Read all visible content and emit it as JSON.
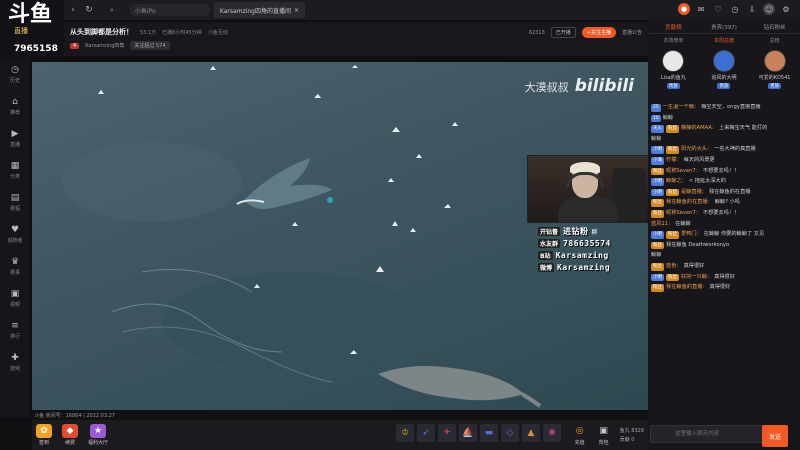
{
  "browser": {
    "search_text": "小鱼iPo",
    "tab_title": "Karsamzing四角的直播间",
    "icons": [
      "home-icon",
      "back-icon",
      "refresh-icon",
      "search-icon"
    ]
  },
  "logo": {
    "mark": "斗鱼",
    "sub": "直播",
    "number": "7965158"
  },
  "sidebar": {
    "items": [
      {
        "label": "历史",
        "icon": "history-icon"
      },
      {
        "label": "推荐",
        "icon": "home-icon"
      },
      {
        "label": "直播",
        "icon": "play-icon"
      },
      {
        "label": "分类",
        "icon": "grid-icon"
      },
      {
        "label": "赛程",
        "icon": "calendar-icon"
      },
      {
        "label": "追随者",
        "icon": "heart-icon"
      },
      {
        "label": "赛事",
        "icon": "trophy-icon"
      },
      {
        "label": "视频",
        "icon": "video-icon"
      },
      {
        "label": "排行",
        "icon": "rank-icon"
      },
      {
        "label": "游戏",
        "icon": "gamepad-icon"
      }
    ]
  },
  "room": {
    "title": "从头到脚都是分析！",
    "meta": [
      "53.1万",
      "已播8小时45分钟",
      "小鱼互动"
    ],
    "host_name": "Karsamzing四角",
    "level_badge": "4",
    "fan_badge": "关注超过 574",
    "room_id": "62313",
    "select": "已开播",
    "follow_label": "+关注主播",
    "share_label": "直播公告"
  },
  "player": {
    "watermark_cn": "大漠叔叔",
    "watermark_brand": "bilibili",
    "footer_text": "斗鱼 房间号：16864 | 2022.03.27"
  },
  "social": [
    {
      "label": "开钻督",
      "value": "进钻粉",
      "extra": "群"
    },
    {
      "label": "水友群",
      "value": "786635574",
      "extra": ""
    },
    {
      "label": "B站",
      "value": "Karsamzing",
      "extra": ""
    },
    {
      "label": "微博",
      "value": "Karsamzing",
      "extra": ""
    }
  ],
  "bottom": {
    "left_buttons": [
      {
        "label": "签到",
        "icon": "gift-icon",
        "color": "#f3a320"
      },
      {
        "label": "续费",
        "icon": "bag-icon",
        "color": "#e34b2c"
      },
      {
        "label": "福利大厅",
        "icon": "star-icon",
        "color": "#9b59d6"
      }
    ],
    "gifts": [
      "crown-icon",
      "rocket-icon",
      "plane-icon",
      "ship-icon",
      "car-icon",
      "diamond-icon",
      "cake-icon",
      "flower-icon"
    ],
    "stats": [
      {
        "label": "鱼丸",
        "value": "8329"
      },
      {
        "label": "贡献",
        "value": "0"
      }
    ],
    "buttons": [
      {
        "label": "充值",
        "icon": "coin-icon"
      },
      {
        "label": "背包",
        "icon": "backpack-icon"
      }
    ]
  },
  "chat": {
    "tabs": [
      {
        "label": "贡献榜",
        "active": true
      },
      {
        "label": "贵宾(397)",
        "active": false
      },
      {
        "label": "钻石粉丝",
        "active": false
      }
    ],
    "sub_tabs": [
      {
        "label": "本场榜单",
        "active": false
      },
      {
        "label": "本周总榜",
        "active": true
      },
      {
        "label": "总榜",
        "active": false
      }
    ],
    "ranks": [
      {
        "name": "Lisa的鱼丸",
        "badge": "贵族",
        "color": "#e8e8e8"
      },
      {
        "name": "追风的大明",
        "badge": "贵族",
        "color": "#3b6fd1"
      },
      {
        "name": "可爱的KD541",
        "badge": "贵族",
        "color": "#c9825c"
      }
    ],
    "messages": [
      {
        "lvl": "25",
        "fan": "",
        "user": "一生温一个偶：",
        "text": "梅宝天空，ongy直接直播"
      },
      {
        "lvl": "10",
        "fan": "",
        "user": "",
        "text": "鲸鲸"
      },
      {
        "lvl": "天火",
        "fan": "粉丝",
        "user": "静静的AMAA：",
        "text": "上来梅宝天气 能打的"
      },
      {
        "lvl": "",
        "fan": "",
        "user": "",
        "text": "鲸鲸"
      },
      {
        "lvl": "小明",
        "fan": "粉丝",
        "user": "阳光的大头：",
        "text": "一名大神的真直播"
      },
      {
        "lvl": "小满",
        "fan": "",
        "user": "柠檬：",
        "text": "每天的风景更"
      },
      {
        "lvl": "",
        "fan": "粉丝",
        "user": "昵称Seven7：",
        "text": "不想要去吗！！"
      },
      {
        "lvl": "小明",
        "fan": "",
        "user": "鲸鲸之：",
        "text": "<  拖延太深大的"
      },
      {
        "lvl": "小明",
        "fan": "粉丝",
        "user": "是鲸直播：",
        "text": "我在鲸鱼的在直播"
      },
      {
        "lvl": "",
        "fan": "粉丝",
        "user": "我在鲸鱼的在直播：",
        "text": "鲸鲸? 小吗"
      },
      {
        "lvl": "",
        "fan": "粉丝",
        "user": "昵称Seven7：",
        "text": "不想要去吗！！"
      },
      {
        "lvl": "",
        "fan": "",
        "user": "蓝风11：",
        "text": "在鲸鲸"
      },
      {
        "lvl": "小明",
        "fan": "粉丝",
        "user": "爱鸭门：",
        "text": "在鲸鲸 你要的鲸鲸了 又见"
      },
      {
        "lvl": "",
        "fan": "粉丝",
        "user": "",
        "text": "我在鲸鱼 Deathworkonyo"
      },
      {
        "lvl": "",
        "fan": "",
        "user": "",
        "text": "鲸鲸"
      },
      {
        "lvl": "",
        "fan": "粉丝",
        "user": "蓝色：",
        "text": "真得很好"
      },
      {
        "lvl": "小明",
        "fan": "粉丝",
        "user": "好的一只鲸：",
        "text": "真得很好"
      },
      {
        "lvl": "",
        "fan": "粉丝",
        "user": "我在鲸鱼的直播：",
        "text": "真得很好"
      }
    ],
    "tool_icons": [
      "emoji-icon",
      "gift-icon",
      "crown-icon",
      "fan-icon",
      "color-icon",
      "red-packet-icon",
      "more-icon"
    ],
    "input_placeholder": "这里输入聊天内容",
    "send_label": "发送"
  }
}
